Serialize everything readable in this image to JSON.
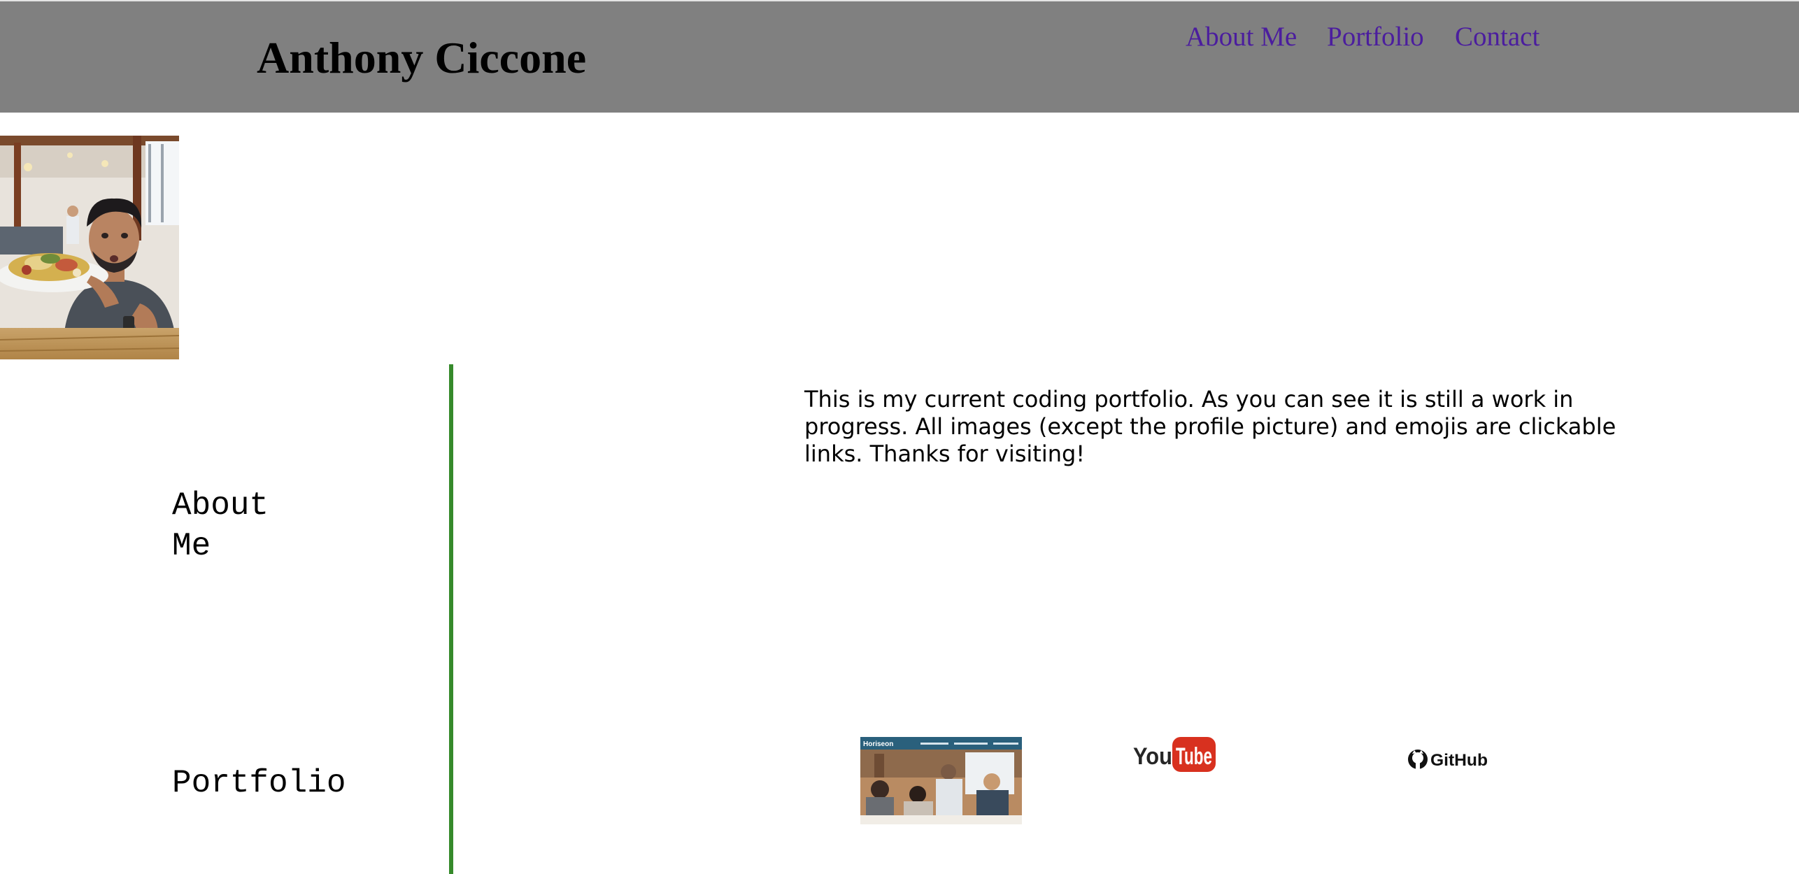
{
  "header": {
    "site_title": "Anthony Ciccone",
    "nav": [
      "About Me",
      "Portfolio",
      "Contact"
    ],
    "background_color": "#808080",
    "link_color": "#4b1d9e"
  },
  "sidebar": {
    "about_heading": "About Me",
    "portfolio_heading": "Portfolio",
    "divider_color": "#368a2b"
  },
  "main": {
    "intro": "This is my current coding portfolio. As you can see it is still a work in progress. All images (except the profile picture) and emojis are clickable links. Thanks for visiting!"
  },
  "images": {
    "profile_photo": "profile-photo",
    "project_thumbnail_brand": "Horiseon",
    "youtube_logo": {
      "left": "You",
      "right": "Tube"
    },
    "github_logo": "GitHub"
  }
}
